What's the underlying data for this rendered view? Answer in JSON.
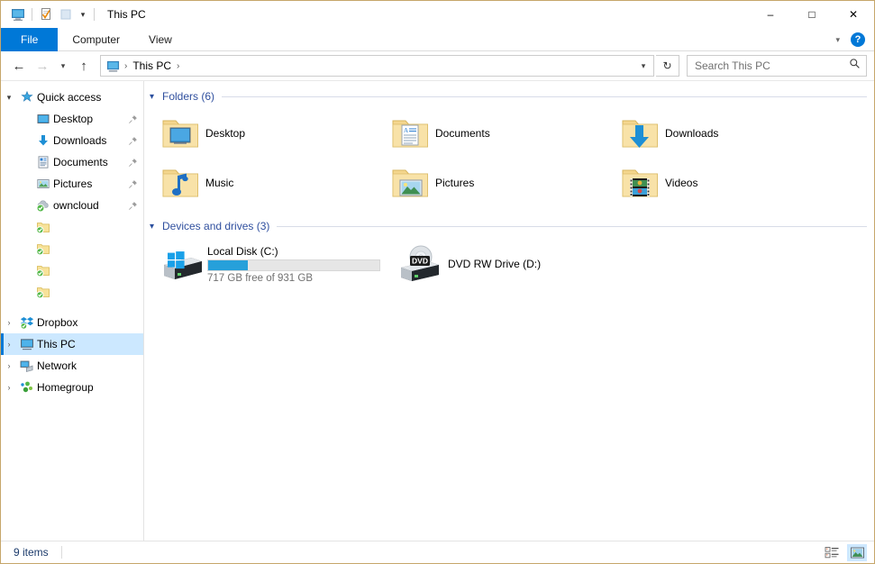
{
  "window": {
    "title": "This PC",
    "quick_access_toolbar": [
      {
        "name": "properties-this-pc",
        "icon": "monitor-icon"
      },
      {
        "name": "properties",
        "icon": "properties-icon"
      },
      {
        "name": "new-folder",
        "icon": "new-folder-icon"
      }
    ],
    "qat_dropdown_icon": "chevron-down-icon",
    "controls": {
      "minimize": "‒",
      "maximize": "□",
      "close": "✕"
    }
  },
  "ribbon": {
    "tabs": [
      {
        "label": "File",
        "active": true
      },
      {
        "label": "Computer",
        "active": false
      },
      {
        "label": "View",
        "active": false
      }
    ],
    "collapse_icon": "chevron-down-icon",
    "help_label": "?"
  },
  "address_bar": {
    "back_icon": "arrow-left-icon",
    "forward_icon": "arrow-right-icon",
    "recent_icon": "chevron-down-icon",
    "up_icon": "arrow-up-icon",
    "breadcrumb_icon": "monitor-icon",
    "breadcrumb": "This PC",
    "breadcrumb_sep": "›",
    "dropdown_icon": "chevron-down-icon",
    "refresh_icon": "refresh-icon"
  },
  "search": {
    "placeholder": "Search This PC",
    "value": "",
    "icon": "search-icon"
  },
  "sidebar": {
    "items": [
      {
        "label": "Quick access",
        "icon": "star-icon",
        "chevron": "⌄",
        "expanded": true,
        "level": 0,
        "pinned": false,
        "selected": false
      },
      {
        "label": "Desktop",
        "icon": "desktop-icon",
        "level": 1,
        "pinned": true,
        "selected": false
      },
      {
        "label": "Downloads",
        "icon": "download-icon",
        "level": 1,
        "pinned": true,
        "selected": false
      },
      {
        "label": "Documents",
        "icon": "document-icon",
        "level": 1,
        "pinned": true,
        "selected": false
      },
      {
        "label": "Pictures",
        "icon": "picture-icon",
        "level": 1,
        "pinned": true,
        "selected": false
      },
      {
        "label": "owncloud",
        "icon": "owncloud-sync-icon",
        "level": 1,
        "pinned": true,
        "selected": false
      },
      {
        "label": "",
        "redacted": true,
        "icon": "folder-sync-icon",
        "level": 1,
        "pinned": false,
        "selected": false,
        "blur_width": 72
      },
      {
        "label": "",
        "redacted": true,
        "icon": "folder-sync-icon",
        "level": 1,
        "pinned": false,
        "selected": false,
        "blur_width": 62
      },
      {
        "label": "",
        "redacted": true,
        "icon": "folder-sync-icon",
        "level": 1,
        "pinned": false,
        "selected": false,
        "blur_width": 56
      },
      {
        "label": "",
        "redacted": true,
        "icon": "folder-sync-icon",
        "level": 1,
        "pinned": false,
        "selected": false,
        "blur_width": 66
      },
      {
        "label": "Dropbox",
        "icon": "dropbox-icon",
        "chevron": "›",
        "level": 0,
        "pinned": false,
        "selected": false
      },
      {
        "label": "This PC",
        "icon": "monitor-icon",
        "chevron": "›",
        "level": 0,
        "pinned": false,
        "selected": true
      },
      {
        "label": "Network",
        "icon": "network-icon",
        "chevron": "›",
        "level": 0,
        "pinned": false,
        "selected": false
      },
      {
        "label": "Homegroup",
        "icon": "homegroup-icon",
        "chevron": "›",
        "level": 0,
        "pinned": false,
        "selected": false
      }
    ]
  },
  "content": {
    "groups": [
      {
        "title": "Folders (6)",
        "chevron": "⌄",
        "type": "folders",
        "items": [
          {
            "label": "Desktop",
            "icon": "folder-desktop-icon"
          },
          {
            "label": "Documents",
            "icon": "folder-documents-icon"
          },
          {
            "label": "Downloads",
            "icon": "folder-downloads-icon"
          },
          {
            "label": "Music",
            "icon": "folder-music-icon"
          },
          {
            "label": "Pictures",
            "icon": "folder-pictures-icon"
          },
          {
            "label": "Videos",
            "icon": "folder-videos-icon"
          }
        ]
      },
      {
        "title": "Devices and drives (3)",
        "chevron": "⌄",
        "type": "drives",
        "items": [
          {
            "label": "Local Disk (C:)",
            "icon": "hard-drive-windows-icon",
            "has_bar": true,
            "free_text": "717 GB free of 931 GB",
            "used_percent": 23,
            "bar_color": "#26a0da"
          },
          {
            "label": "DVD RW Drive (D:)",
            "icon": "dvd-drive-icon",
            "has_bar": false
          }
        ]
      }
    ]
  },
  "status_bar": {
    "item_count": "9 items",
    "views": [
      {
        "name": "details-view-button",
        "icon": "details-list-icon",
        "active": false
      },
      {
        "name": "large-icons-view-button",
        "icon": "large-icons-icon",
        "active": true
      }
    ]
  },
  "colors": {
    "accent": "#0078d7",
    "selection": "#cce8ff",
    "group_header": "#2f4f9e",
    "bar_fill": "#26a0da",
    "folder_yellow": "#f6d68a",
    "window_border": "#c6a66a"
  }
}
